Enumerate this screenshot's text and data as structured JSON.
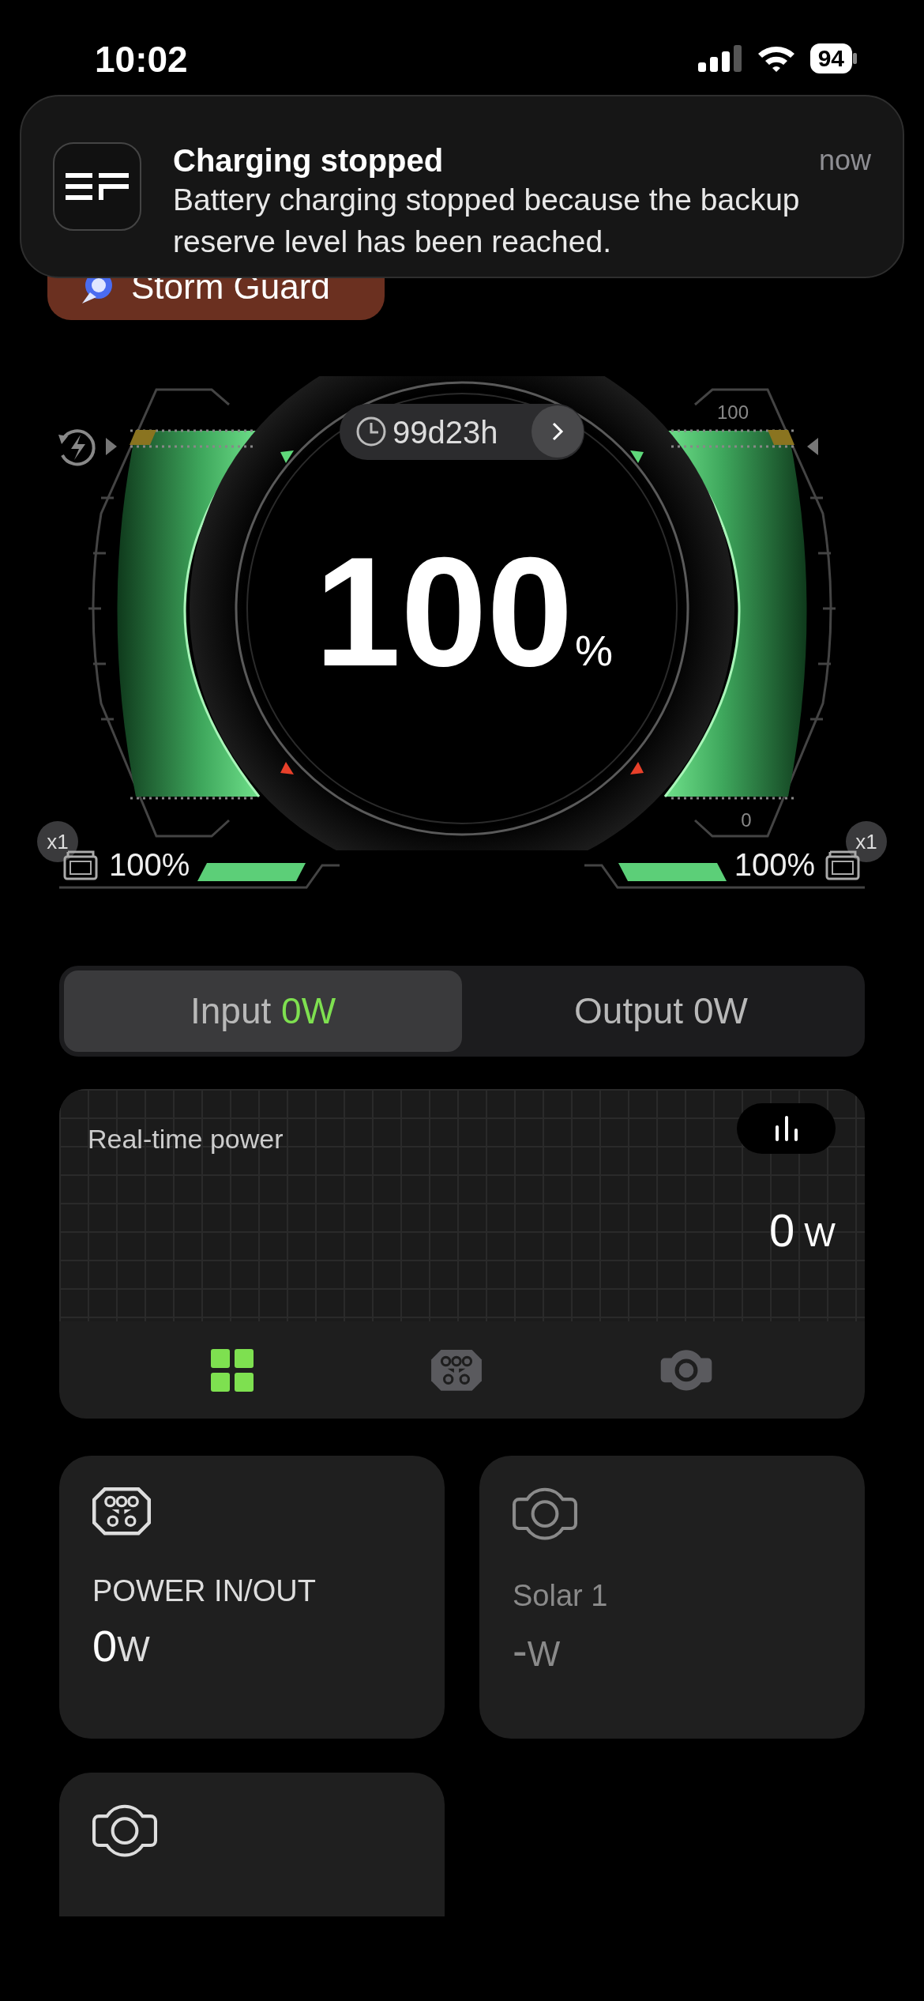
{
  "status_bar": {
    "time": "10:02",
    "battery": "94"
  },
  "notification": {
    "title": "Charging stopped",
    "time": "now",
    "body": "Battery charging stopped because the backup reserve level has been reached."
  },
  "mode_chip": {
    "label": "Storm Guard"
  },
  "gauge": {
    "remaining": "99d23h",
    "percent": "100",
    "unit": "%",
    "scale_max": "100",
    "scale_min": "0",
    "packs": [
      {
        "count": "x1",
        "reading": "100%",
        "level": 1
      },
      {
        "count": "x1",
        "reading": "100%",
        "level": 1
      }
    ]
  },
  "power_tabs": [
    {
      "label": "Input",
      "value": "0W",
      "selected": true
    },
    {
      "label": "Output",
      "value": "0W",
      "selected": false
    }
  ],
  "realtime": {
    "title": "Real-time power",
    "value": "0",
    "unit": "W",
    "sources": [
      {
        "kind": "grid",
        "selected": true
      },
      {
        "kind": "connector",
        "selected": false
      },
      {
        "kind": "solar",
        "selected": false
      }
    ]
  },
  "ports": [
    {
      "kind": "connector",
      "label": "POWER IN/OUT",
      "value": "0",
      "unit": "W",
      "disabled": false
    },
    {
      "kind": "solar",
      "label": "Solar 1",
      "value": "-",
      "unit": "W",
      "disabled": true
    },
    {
      "kind": "solar"
    }
  ]
}
